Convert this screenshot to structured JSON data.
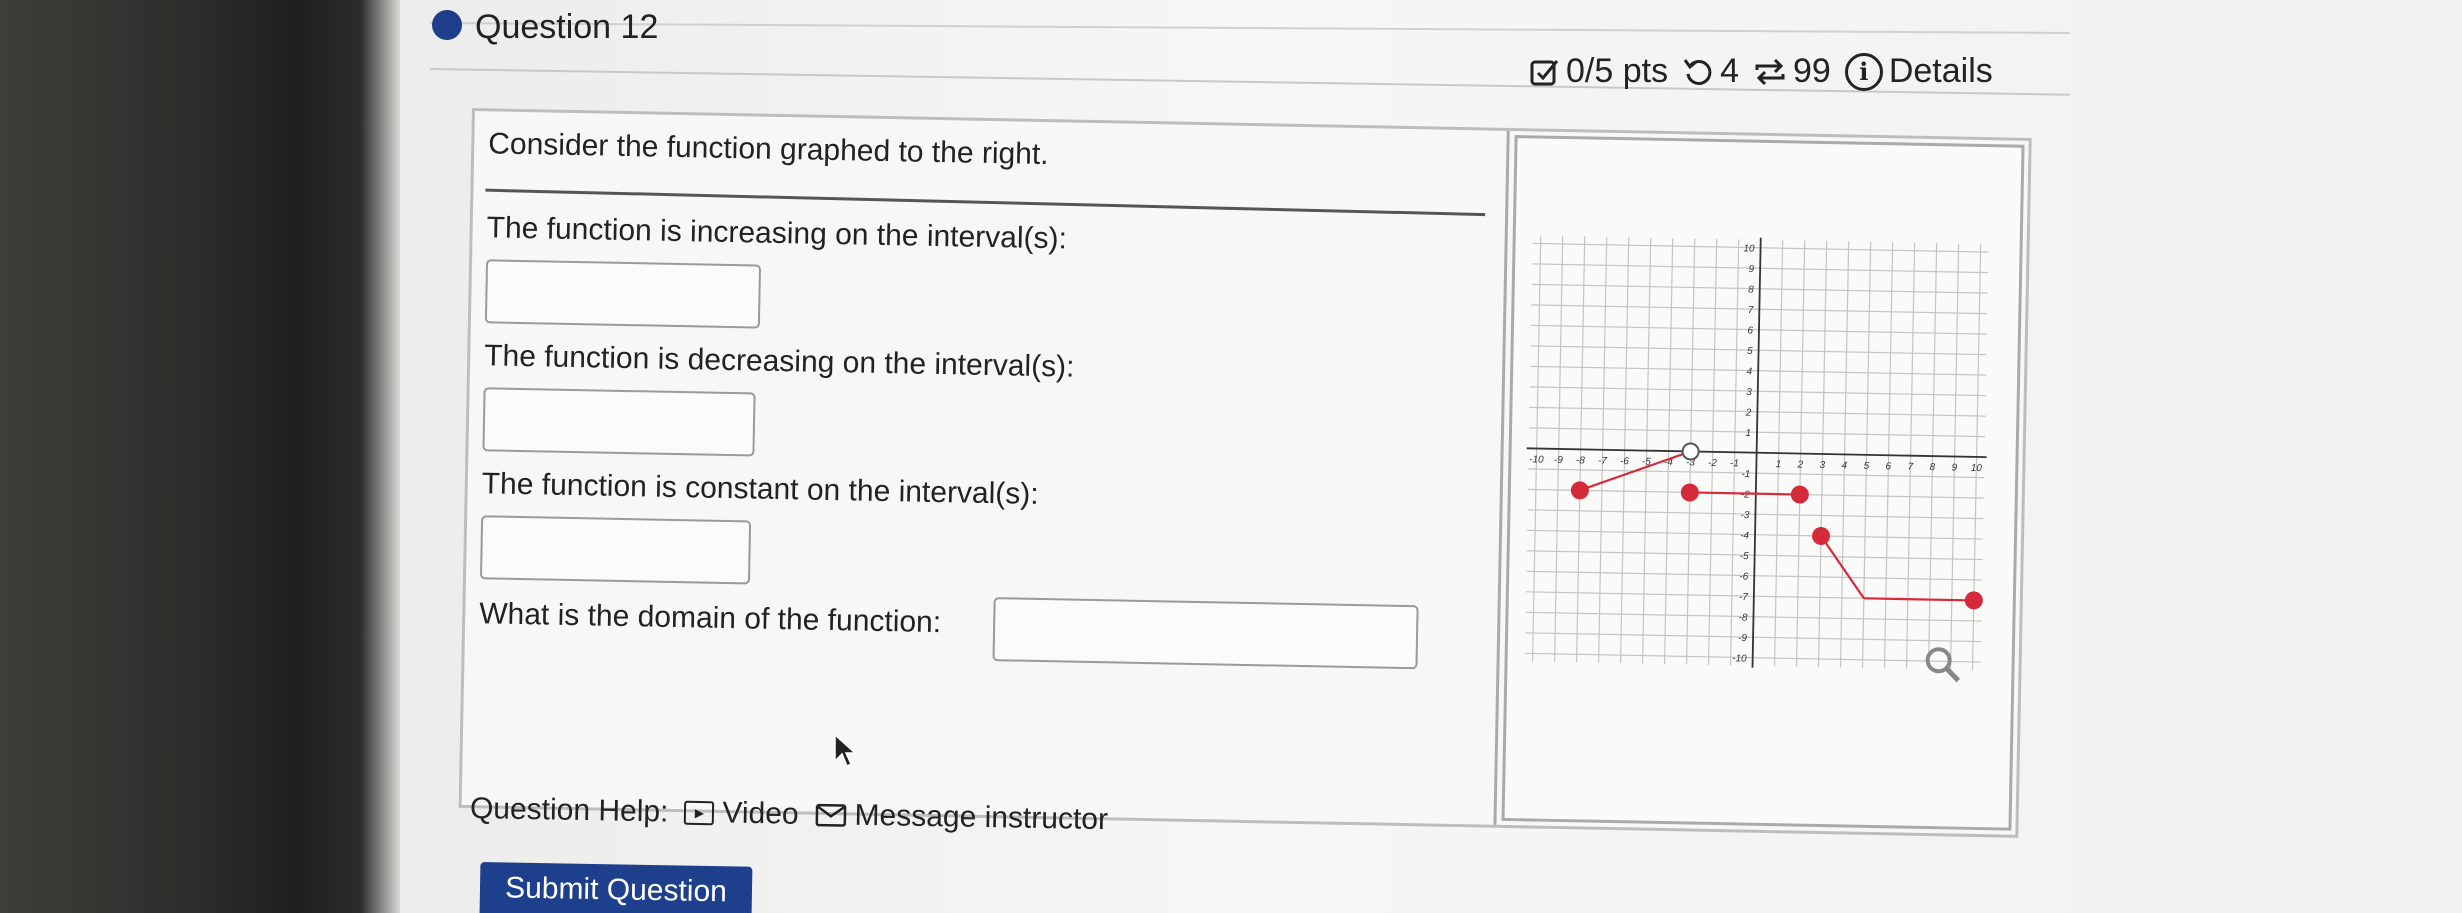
{
  "question": {
    "title": "Question 12",
    "points": "0/5 pts",
    "attempts_remaining": "4",
    "submissions": "99",
    "details_label": "Details",
    "prompt": "Consider the function graphed to the right.",
    "parts": [
      {
        "label": "The function is increasing on the interval(s):",
        "value": "",
        "placeholder": ""
      },
      {
        "label": "The function is decreasing on the interval(s):",
        "value": "",
        "placeholder": ""
      },
      {
        "label": "The function is constant on the interval(s):",
        "value": "",
        "placeholder": ""
      },
      {
        "label": "What is the domain of the function:",
        "value": "",
        "placeholder": ""
      }
    ]
  },
  "help": {
    "label": "Question Help:",
    "video_label": "Video",
    "message_label": "Message instructor"
  },
  "submit_label": "Submit Question",
  "graph": {
    "x_range": [
      -10,
      10
    ],
    "y_range": [
      -10,
      10
    ],
    "x_tick_labels": [
      "-10",
      "-9",
      "-8",
      "-7",
      "-6",
      "-5",
      "-4",
      "-3",
      "-2",
      "-1",
      "1",
      "2",
      "3",
      "4",
      "5",
      "6",
      "7",
      "8",
      "9",
      "10"
    ],
    "y_tick_labels": [
      "10",
      "9",
      "8",
      "7",
      "6",
      "5",
      "4",
      "3",
      "2",
      "1",
      "-1",
      "-2",
      "-3",
      "-4",
      "-5",
      "-6",
      "-7",
      "-8",
      "-9",
      "-10"
    ],
    "segments": [
      {
        "from": [
          -8,
          -2
        ],
        "to": [
          -3,
          0
        ]
      },
      {
        "from": [
          -3,
          -2
        ],
        "to": [
          2,
          -2
        ]
      },
      {
        "from": [
          3,
          -4
        ],
        "to": [
          5,
          -7
        ]
      },
      {
        "from": [
          5,
          -7
        ],
        "to": [
          10,
          -7
        ]
      }
    ],
    "closed_points": [
      [
        -8,
        -2
      ],
      [
        -3,
        -2
      ],
      [
        2,
        -2
      ],
      [
        3,
        -4
      ],
      [
        10,
        -7
      ]
    ],
    "open_points": [
      [
        -3,
        0
      ]
    ],
    "curve_color": "#d42a3a",
    "accent_color": "#1e3f8c"
  }
}
